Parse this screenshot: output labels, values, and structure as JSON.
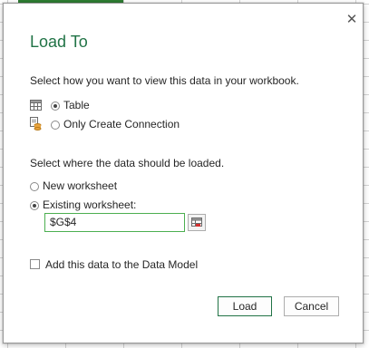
{
  "dialog": {
    "title": "Load To",
    "view_prompt": "Select how you want to view this data in your workbook.",
    "view_options": [
      {
        "label": "Table",
        "icon": "table-icon",
        "selected": true
      },
      {
        "label": "Only Create Connection",
        "icon": "connection-icon",
        "selected": false
      }
    ],
    "location_prompt": "Select where the data should be loaded.",
    "location_options": [
      {
        "label": "New worksheet",
        "selected": false
      },
      {
        "label": "Existing worksheet:",
        "selected": true
      }
    ],
    "cell_reference": "$G$4",
    "data_model_label": "Add this data to the Data Model",
    "data_model_checked": false,
    "load_label": "Load",
    "cancel_label": "Cancel",
    "close_glyph": "✕"
  },
  "colors": {
    "accent": "#217346",
    "input_border": "#4caf50"
  }
}
